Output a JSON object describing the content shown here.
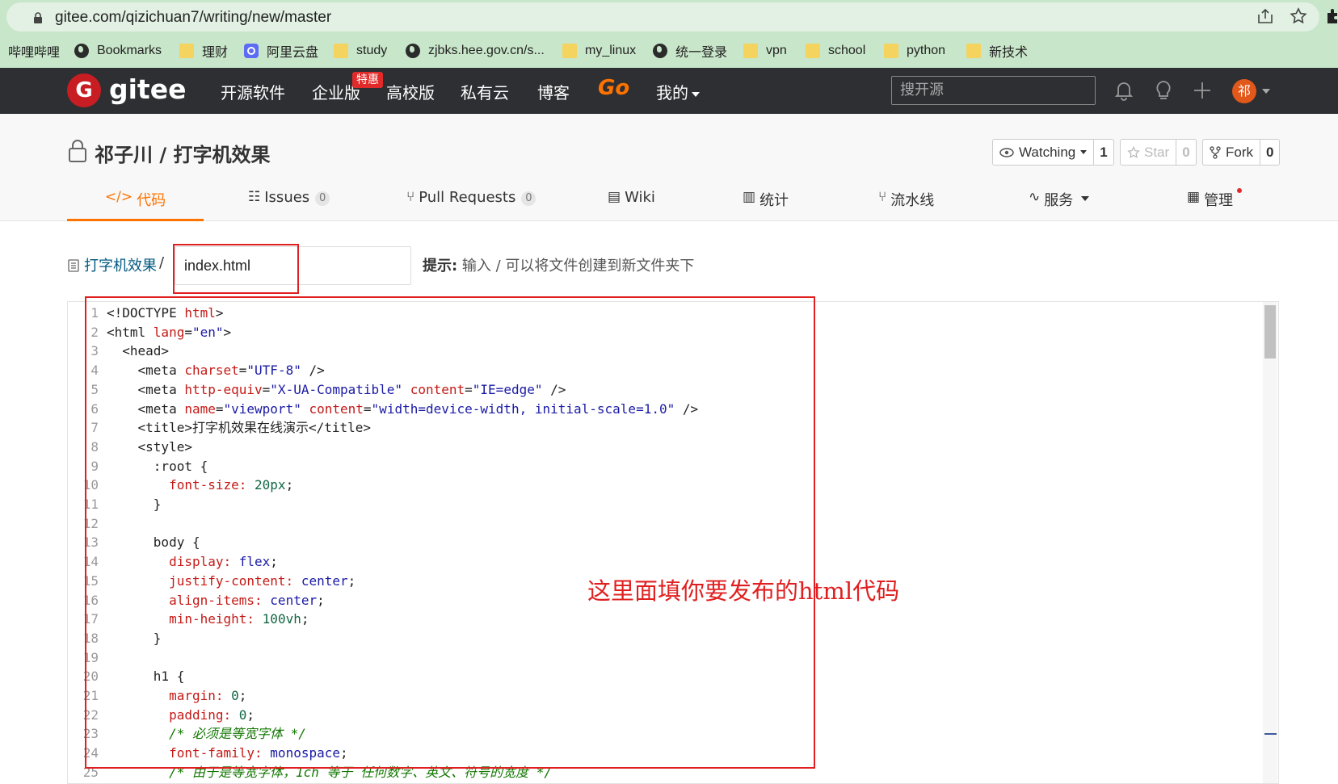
{
  "browser": {
    "url": "gitee.com/qizichuan7/writing/new/master",
    "bookmarks": [
      {
        "label": "哔哩哔哩",
        "icon": "none"
      },
      {
        "label": "Bookmarks",
        "icon": "globe-icon"
      },
      {
        "label": "理财",
        "icon": "folder-icon"
      },
      {
        "label": "阿里云盘",
        "icon": "aliyun-icon"
      },
      {
        "label": "study",
        "icon": "folder-icon"
      },
      {
        "label": "zjbks.hee.gov.cn/s...",
        "icon": "globe-icon"
      },
      {
        "label": "my_linux",
        "icon": "folder-icon"
      },
      {
        "label": "统一登录",
        "icon": "globe-icon"
      },
      {
        "label": "vpn",
        "icon": "folder-icon"
      },
      {
        "label": "school",
        "icon": "folder-icon"
      },
      {
        "label": "python",
        "icon": "folder-icon"
      },
      {
        "label": "新技术",
        "icon": "folder-icon"
      }
    ]
  },
  "header": {
    "logo_text": "gitee",
    "nav": [
      "开源软件",
      "企业版",
      "高校版",
      "私有云",
      "博客",
      "Go",
      "我的"
    ],
    "promo_badge": "特惠",
    "search_placeholder": "搜开源",
    "avatar_text": "祁"
  },
  "repo": {
    "title": "祁子川 / 打字机效果",
    "watching_label": "Watching",
    "watching_count": "1",
    "star_label": "Star",
    "star_count": "0",
    "fork_label": "Fork",
    "fork_count": "0",
    "tabs": [
      {
        "label": "代码",
        "icon": "code-icon"
      },
      {
        "label": "Issues",
        "badge": "0",
        "icon": "issues-icon"
      },
      {
        "label": "Pull Requests",
        "badge": "0",
        "icon": "pull-request-icon"
      },
      {
        "label": "Wiki",
        "icon": "wiki-icon"
      },
      {
        "label": "统计",
        "icon": "chart-icon"
      },
      {
        "label": "流水线",
        "icon": "pipeline-icon"
      },
      {
        "label": "服务",
        "icon": "service-icon"
      },
      {
        "label": "管理",
        "icon": "manage-icon"
      }
    ]
  },
  "path": {
    "repo_link": "打字机效果",
    "separator": "/",
    "filename": "index.html",
    "hint_label": "提示:",
    "hint_text": " 输入 / 可以将文件创建到新文件夹下"
  },
  "annotation": "这里面填你要发布的html代码",
  "code_lines": [
    {
      "n": "1",
      "t": [
        [
          "tg",
          "<!DOCTYPE "
        ],
        [
          "at",
          "html"
        ],
        [
          "tg",
          ">"
        ]
      ]
    },
    {
      "n": "2",
      "t": [
        [
          "tg",
          "<html "
        ],
        [
          "at",
          "lang"
        ],
        [
          "tg",
          "="
        ],
        [
          "st",
          "\"en\""
        ],
        [
          "tg",
          ">"
        ]
      ]
    },
    {
      "n": "3",
      "t": [
        [
          "tg",
          "  <head>"
        ]
      ]
    },
    {
      "n": "4",
      "t": [
        [
          "tg",
          "    <meta "
        ],
        [
          "at",
          "charset"
        ],
        [
          "tg",
          "="
        ],
        [
          "st",
          "\"UTF-8\""
        ],
        [
          "tg",
          " />"
        ]
      ]
    },
    {
      "n": "5",
      "t": [
        [
          "tg",
          "    <meta "
        ],
        [
          "at",
          "http-equiv"
        ],
        [
          "tg",
          "="
        ],
        [
          "st",
          "\"X-UA-Compatible\""
        ],
        [
          "tg",
          " "
        ],
        [
          "at",
          "content"
        ],
        [
          "tg",
          "="
        ],
        [
          "st",
          "\"IE=edge\""
        ],
        [
          "tg",
          " />"
        ]
      ]
    },
    {
      "n": "6",
      "t": [
        [
          "tg",
          "    <meta "
        ],
        [
          "at",
          "name"
        ],
        [
          "tg",
          "="
        ],
        [
          "st",
          "\"viewport\""
        ],
        [
          "tg",
          " "
        ],
        [
          "at",
          "content"
        ],
        [
          "tg",
          "="
        ],
        [
          "st",
          "\"width=device-width, initial-scale=1.0\""
        ],
        [
          "tg",
          " />"
        ]
      ]
    },
    {
      "n": "7",
      "t": [
        [
          "tg",
          "    <title>"
        ],
        [
          "tx",
          "打字机效果在线演示"
        ],
        [
          "tg",
          "</title>"
        ]
      ]
    },
    {
      "n": "8",
      "t": [
        [
          "tg",
          "    <style>"
        ]
      ]
    },
    {
      "n": "9",
      "t": [
        [
          "tx",
          "      :root {"
        ]
      ]
    },
    {
      "n": "10",
      "t": [
        [
          "tx",
          "        "
        ],
        [
          "pr",
          "font-size:"
        ],
        [
          "tx",
          " "
        ],
        [
          "nm",
          "20px"
        ],
        [
          "tx",
          ";"
        ]
      ]
    },
    {
      "n": "11",
      "t": [
        [
          "tx",
          "      }"
        ]
      ]
    },
    {
      "n": "12",
      "t": [
        [
          "tx",
          ""
        ]
      ]
    },
    {
      "n": "13",
      "t": [
        [
          "tx",
          "      body {"
        ]
      ]
    },
    {
      "n": "14",
      "t": [
        [
          "tx",
          "        "
        ],
        [
          "pr",
          "display:"
        ],
        [
          "tx",
          " "
        ],
        [
          "vl",
          "flex"
        ],
        [
          "tx",
          ";"
        ]
      ]
    },
    {
      "n": "15",
      "t": [
        [
          "tx",
          "        "
        ],
        [
          "pr",
          "justify-content:"
        ],
        [
          "tx",
          " "
        ],
        [
          "vl",
          "center"
        ],
        [
          "tx",
          ";"
        ]
      ]
    },
    {
      "n": "16",
      "t": [
        [
          "tx",
          "        "
        ],
        [
          "pr",
          "align-items:"
        ],
        [
          "tx",
          " "
        ],
        [
          "vl",
          "center"
        ],
        [
          "tx",
          ";"
        ]
      ]
    },
    {
      "n": "17",
      "t": [
        [
          "tx",
          "        "
        ],
        [
          "pr",
          "min-height:"
        ],
        [
          "tx",
          " "
        ],
        [
          "nm",
          "100vh"
        ],
        [
          "tx",
          ";"
        ]
      ]
    },
    {
      "n": "18",
      "t": [
        [
          "tx",
          "      }"
        ]
      ]
    },
    {
      "n": "19",
      "t": [
        [
          "tx",
          ""
        ]
      ]
    },
    {
      "n": "20",
      "t": [
        [
          "tx",
          "      h1 {"
        ]
      ]
    },
    {
      "n": "21",
      "t": [
        [
          "tx",
          "        "
        ],
        [
          "pr",
          "margin:"
        ],
        [
          "tx",
          " "
        ],
        [
          "nm",
          "0"
        ],
        [
          "tx",
          ";"
        ]
      ]
    },
    {
      "n": "22",
      "t": [
        [
          "tx",
          "        "
        ],
        [
          "pr",
          "padding:"
        ],
        [
          "tx",
          " "
        ],
        [
          "nm",
          "0"
        ],
        [
          "tx",
          ";"
        ]
      ]
    },
    {
      "n": "23",
      "t": [
        [
          "cm",
          "        /* 必须是等宽字体 */"
        ]
      ]
    },
    {
      "n": "24",
      "t": [
        [
          "tx",
          "        "
        ],
        [
          "pr",
          "font-family:"
        ],
        [
          "tx",
          " "
        ],
        [
          "vl",
          "monospace"
        ],
        [
          "tx",
          ";"
        ]
      ]
    },
    {
      "n": "25",
      "t": [
        [
          "cm",
          "        /* 由于是等宽字体，1ch 等于 任何数字、英文、符号的宽度 */"
        ]
      ]
    }
  ]
}
